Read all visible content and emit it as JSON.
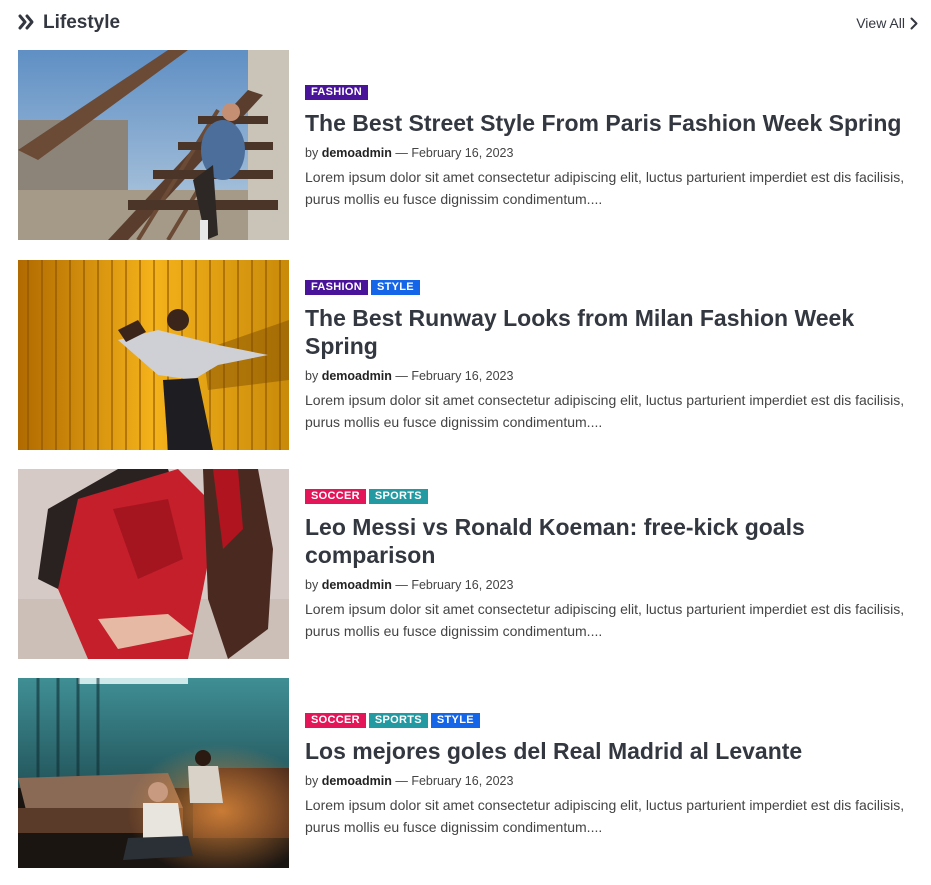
{
  "header": {
    "title": "Lifestyle",
    "view_all": "View All"
  },
  "colors": {
    "fashion": "#4a149a",
    "style": "#1565e8",
    "soccer": "#e5155a",
    "sports": "#2399a1"
  },
  "posts": [
    {
      "tags": [
        {
          "label": "FASHION",
          "color": "#4a149a"
        }
      ],
      "title": "The Best Street Style From Paris Fashion Week Spring",
      "by": "by",
      "author": "demoadmin",
      "sep": "—",
      "date": "February 16, 2023",
      "excerpt": "Lorem ipsum dolor sit amet consectetur adipiscing elit, luctus parturient imperdiet est dis facilisis, purus mollis eu fusce dignissim condimentum...."
    },
    {
      "tags": [
        {
          "label": "FASHION",
          "color": "#4a149a"
        },
        {
          "label": "STYLE",
          "color": "#1565e8"
        }
      ],
      "title": "The Best Runway Looks from Milan Fashion Week Spring",
      "by": "by",
      "author": "demoadmin",
      "sep": "—",
      "date": "February 16, 2023",
      "excerpt": "Lorem ipsum dolor sit amet consectetur adipiscing elit, luctus parturient imperdiet est dis facilisis, purus mollis eu fusce dignissim condimentum...."
    },
    {
      "tags": [
        {
          "label": "SOCCER",
          "color": "#e5155a"
        },
        {
          "label": "SPORTS",
          "color": "#2399a1"
        }
      ],
      "title": "Leo Messi vs Ronald Koeman: free-kick goals comparison",
      "by": "by",
      "author": "demoadmin",
      "sep": "—",
      "date": "February 16, 2023",
      "excerpt": "Lorem ipsum dolor sit amet consectetur adipiscing elit, luctus parturient imperdiet est dis facilisis, purus mollis eu fusce dignissim condimentum...."
    },
    {
      "tags": [
        {
          "label": "SOCCER",
          "color": "#e5155a"
        },
        {
          "label": "SPORTS",
          "color": "#2399a1"
        },
        {
          "label": "STYLE",
          "color": "#1565e8"
        }
      ],
      "title": "Los mejores goles del Real Madrid al Levante",
      "by": "by",
      "author": "demoadmin",
      "sep": "—",
      "date": "February 16, 2023",
      "excerpt": "Lorem ipsum dolor sit amet consectetur adipiscing elit, luctus parturient imperdiet est dis facilisis, purus mollis eu fusce dignissim condimentum...."
    }
  ]
}
